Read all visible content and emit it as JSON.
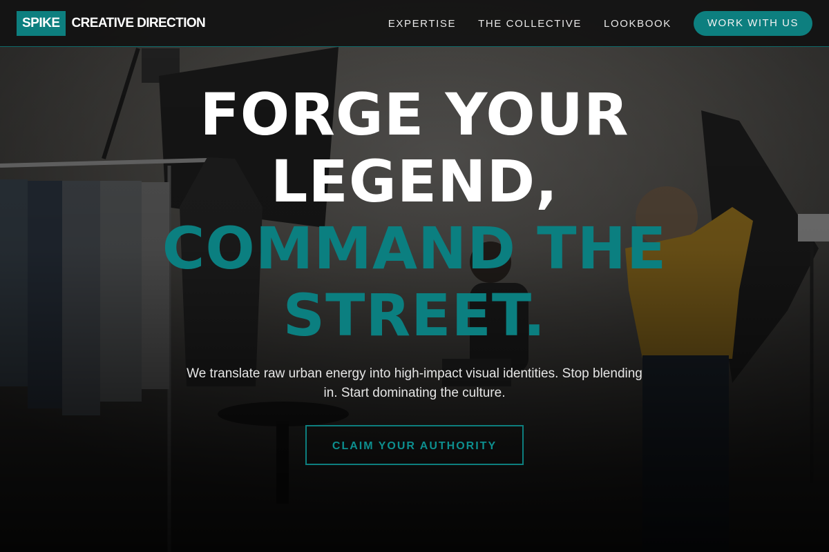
{
  "brand": {
    "logo_box": "SPIKE",
    "name": "CREATIVE DIRECTION"
  },
  "nav": {
    "links": [
      "EXPERTISE",
      "THE COLLECTIVE",
      "LOOKBOOK"
    ],
    "cta": "WORK WITH US"
  },
  "hero": {
    "headline_white_1": "FORGE YOUR",
    "headline_white_2": "LEGEND,",
    "headline_teal_1": "COMMAND THE",
    "headline_teal_2": "STREET.",
    "subtext": "We translate raw urban energy into high-impact visual identities. Stop blending in. Start dominating the culture.",
    "cta": "CLAIM YOUR AUTHORITY"
  },
  "colors": {
    "accent": "#0d7f7f",
    "nav_bg": "#121212",
    "text": "#ffffff"
  }
}
